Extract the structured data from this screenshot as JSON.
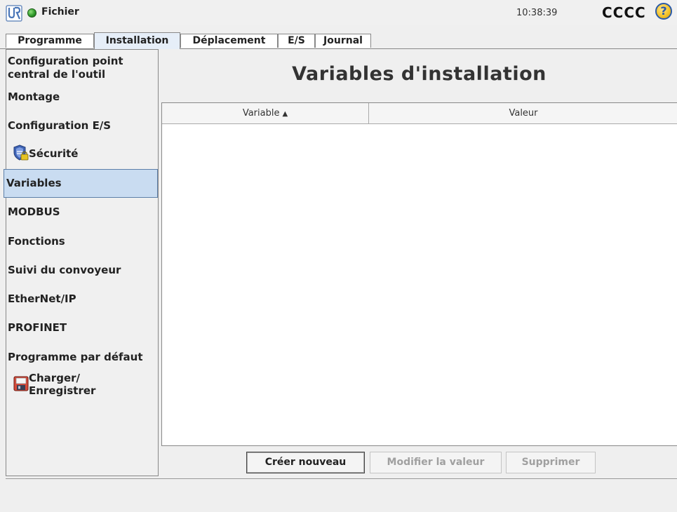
{
  "header": {
    "logo_icon": "universal-robots-logo",
    "status_icon": "status-green-dot",
    "file_menu": "Fichier",
    "time": "10:38:39",
    "robot_name": "CCCC",
    "help_icon": "?"
  },
  "tabs": [
    {
      "label": "Programme",
      "active": false
    },
    {
      "label": "Installation",
      "active": true
    },
    {
      "label": "Déplacement",
      "active": false
    },
    {
      "label": "E/S",
      "active": false
    },
    {
      "label": "Journal",
      "active": false
    }
  ],
  "sidebar": {
    "items": [
      {
        "label": "Configuration point central de l'outil"
      },
      {
        "label": "Montage"
      },
      {
        "label": "Configuration E/S"
      },
      {
        "label": "Sécurité",
        "icon": "shield-lock-icon"
      },
      {
        "label": "Variables",
        "selected": true
      },
      {
        "label": "MODBUS"
      },
      {
        "label": "Fonctions"
      },
      {
        "label": "Suivi du convoyeur"
      },
      {
        "label": "EtherNet/IP"
      },
      {
        "label": "PROFINET"
      },
      {
        "label": "Programme par défaut"
      },
      {
        "label": "Charger/ Enregistrer",
        "icon": "floppy-disk-icon"
      }
    ]
  },
  "main": {
    "title": "Variables d'installation",
    "table": {
      "columns": [
        {
          "label": "Variable",
          "sort": "ascending"
        },
        {
          "label": "Valeur"
        }
      ],
      "rows": []
    },
    "buttons": {
      "create_new": "Créer nouveau",
      "modify_value": "Modifier la valeur",
      "delete": "Supprimer"
    }
  },
  "colors": {
    "selection": "#c9dcf1",
    "background": "#efefef",
    "status_green": "#2f9a2a"
  }
}
